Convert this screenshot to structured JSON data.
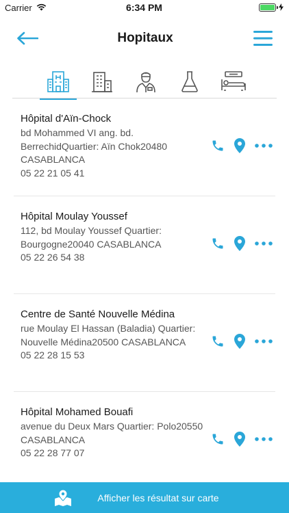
{
  "status": {
    "carrier": "Carrier",
    "time": "6:34 PM"
  },
  "header": {
    "title": "Hopitaux",
    "back_icon": "arrow-left-icon",
    "menu_icon": "hamburger-menu-icon"
  },
  "tabs": [
    {
      "icon": "hospital-building-icon",
      "active": true
    },
    {
      "icon": "clinic-building-icon",
      "active": false
    },
    {
      "icon": "doctor-icon",
      "active": false
    },
    {
      "icon": "lab-flask-icon",
      "active": false
    },
    {
      "icon": "hospital-bed-icon",
      "active": false
    }
  ],
  "items": [
    {
      "name": "Hôpital d'Aïn-Chock",
      "address": "bd Mohammed VI ang. bd. BerrechidQuartier: Aïn Chok20480 CASABLANCA",
      "phone": "05 22 21 05 41"
    },
    {
      "name": "Hôpital Moulay Youssef",
      "address": "112, bd Moulay Youssef Quartier: Bourgogne20040 CASABLANCA",
      "phone": "05 22 26 54 38"
    },
    {
      "name": "Centre de Santé Nouvelle Médina",
      "address": "rue Moulay El Hassan (Baladia) Quartier: Nouvelle Médina20500 CASABLANCA",
      "phone": "05 22 28 15 53"
    },
    {
      "name": "Hôpital Mohamed Bouafi",
      "address": "avenue du Deux Mars Quartier: Polo20550 CASABLANCA",
      "phone": "05 22 28 77 07"
    }
  ],
  "bottom_bar": {
    "label": "Afficher les résultat sur carte",
    "icon": "map-pin-icon"
  },
  "colors": {
    "accent": "#2aa6d8",
    "bottom_bar": "#29aedc",
    "battery": "#4cd964"
  }
}
